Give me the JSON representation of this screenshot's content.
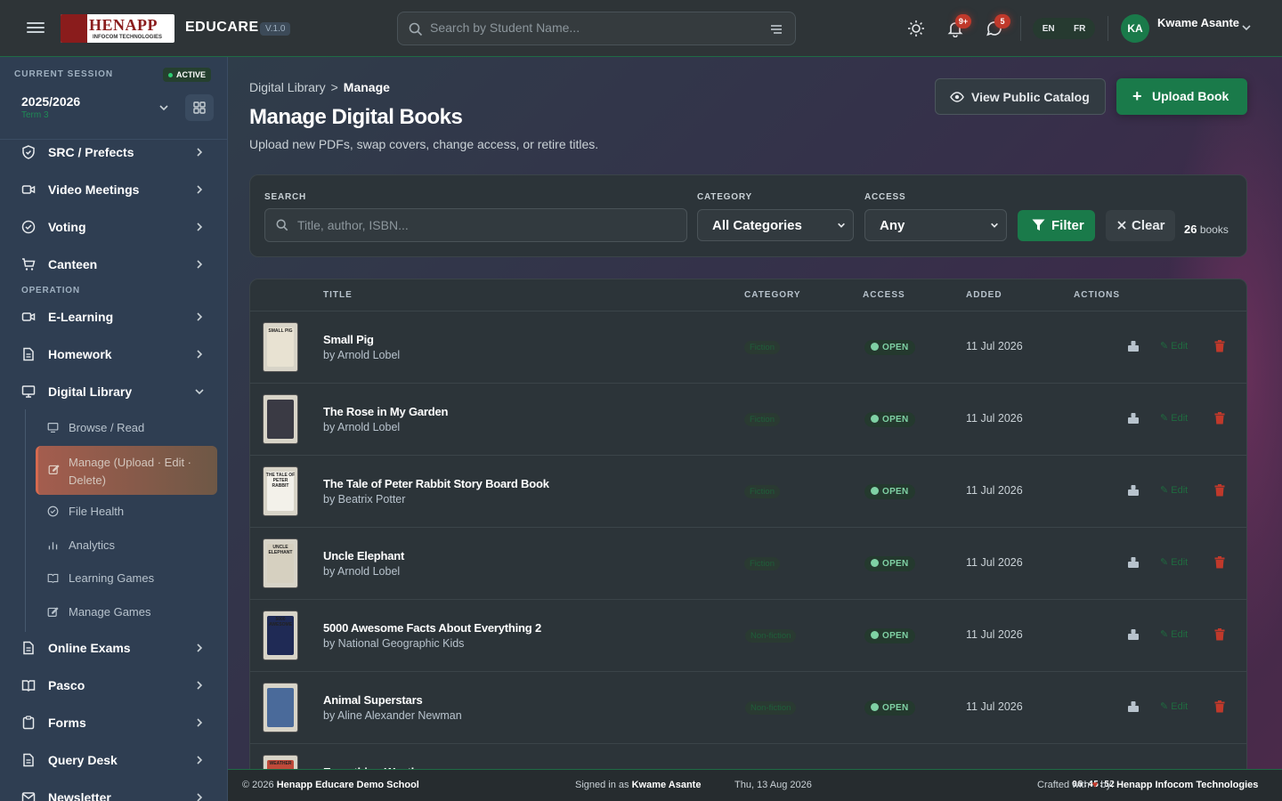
{
  "header": {
    "logo_text": "HENAPP",
    "logo_sub": "INFOCOM TECHNOLOGIES",
    "brand": "EDUCARE",
    "version": "V.1.0",
    "search_placeholder": "Search by Student Name...",
    "notif_badge": "9+",
    "msg_badge": "5",
    "lang_en": "EN",
    "lang_fr": "FR",
    "avatar_initials": "KA",
    "user_name": "Kwame Asante",
    "user_role": ""
  },
  "session": {
    "label": "CURRENT SESSION",
    "status": "ACTIVE",
    "year": "2025/2026",
    "term": "Term 3"
  },
  "sidebar": {
    "items_top": [
      {
        "label": "SRC / Prefects",
        "icon": "shield-icon"
      },
      {
        "label": "Video Meetings",
        "icon": "video-icon"
      },
      {
        "label": "Voting",
        "icon": "check-circle-icon"
      },
      {
        "label": "Canteen",
        "icon": "cart-icon"
      }
    ],
    "section_label": "OPERATION",
    "items_mid": [
      {
        "label": "E-Learning",
        "icon": "video-icon"
      },
      {
        "label": "Homework",
        "icon": "document-icon"
      },
      {
        "label": "Digital Library",
        "icon": "monitor-icon"
      }
    ],
    "subitems": [
      {
        "label": "Browse / Read"
      },
      {
        "label": "Manage (Upload · Edit · Delete)"
      },
      {
        "label": "File Health"
      },
      {
        "label": "Analytics"
      },
      {
        "label": "Learning Games"
      },
      {
        "label": "Manage Games"
      }
    ],
    "items_bottom": [
      {
        "label": "Online Exams"
      },
      {
        "label": "Pasco"
      },
      {
        "label": "Forms"
      },
      {
        "label": "Query Desk"
      },
      {
        "label": "Newsletter"
      }
    ]
  },
  "page": {
    "breadcrumb_root": "Digital Library",
    "breadcrumb_current": "Manage",
    "title": "Manage Digital Books",
    "description": "Upload new PDFs, swap covers, change access, or retire titles.",
    "view_catalog_label": "View Public Catalog",
    "upload_label": "Upload Book"
  },
  "filters": {
    "search_label": "SEARCH",
    "search_placeholder": "Title, author, ISBN...",
    "category_label": "CATEGORY",
    "category_value": "All Categories",
    "access_label": "ACCESS",
    "access_value": "Any",
    "filter_label": "Filter",
    "clear_label": "Clear",
    "count": "26",
    "count_suffix": "books"
  },
  "table": {
    "columns": [
      "TITLE",
      "CATEGORY",
      "ACCESS",
      "ADDED",
      "ACTIONS"
    ],
    "edit_label": "Edit",
    "rows": [
      {
        "title": "Small Pig",
        "author": "by Arnold Lobel",
        "category": "Fiction",
        "access": "OPEN",
        "added": "11 Jul 2026",
        "cover_text": "SMALL PIG",
        "cover_color": "#e8e2d2"
      },
      {
        "title": "The Rose in My Garden",
        "author": "by Arnold Lobel",
        "category": "Fiction",
        "access": "OPEN",
        "added": "11 Jul 2026",
        "cover_text": "",
        "cover_color": "#3a3a44"
      },
      {
        "title": "The Tale of Peter Rabbit Story Board Book",
        "author": "by Beatrix Potter",
        "category": "Fiction",
        "access": "OPEN",
        "added": "11 Jul 2026",
        "cover_text": "THE TALE OF PETER RABBIT",
        "cover_color": "#f3f1ea"
      },
      {
        "title": "Uncle Elephant",
        "author": "by Arnold Lobel",
        "category": "Fiction",
        "access": "OPEN",
        "added": "11 Jul 2026",
        "cover_text": "UNCLE ELEPHANT",
        "cover_color": "#d6d0c0"
      },
      {
        "title": "5000 Awesome Facts About Everything 2",
        "author": "by National Geographic Kids",
        "category": "Non-fiction",
        "access": "OPEN",
        "added": "11 Jul 2026",
        "cover_text": "5000 AWESOME",
        "cover_color": "#1f2a55"
      },
      {
        "title": "Animal Superstars",
        "author": "by Aline Alexander Newman",
        "category": "Non-fiction",
        "access": "OPEN",
        "added": "11 Jul 2026",
        "cover_text": "",
        "cover_color": "#4a6a9a"
      },
      {
        "title": "Everything Weather",
        "author": "",
        "category": "",
        "access": "",
        "added": "",
        "cover_text": "WEATHER",
        "cover_color": "#c04a3a"
      }
    ]
  },
  "footer": {
    "copyright": "© 2026",
    "school": "Henapp Educare Demo School",
    "signed_prefix": "Signed in as",
    "signed_user": "Kwame Asante",
    "date": "Thu, 13 Aug 2026",
    "time": "06:45:52",
    "crafted_prefix": "Crafted with",
    "crafted_by": "by:",
    "company": "Henapp Infocom Technologies"
  },
  "colors": {
    "accent": "#1a7a4a",
    "danger": "#c0392b",
    "active_sub": "#a45d4e"
  }
}
